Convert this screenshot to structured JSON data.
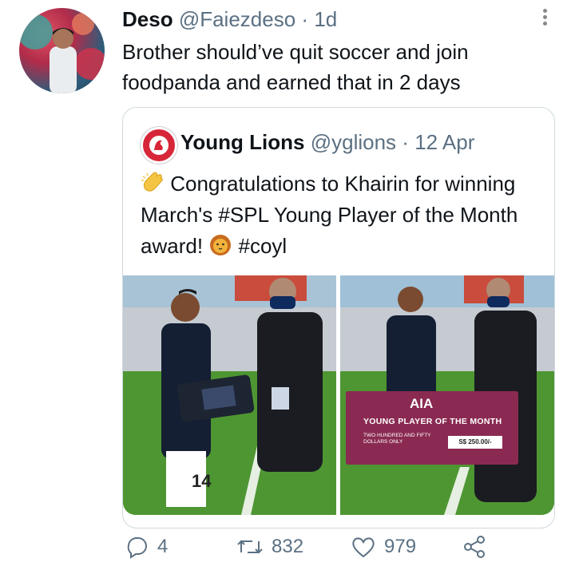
{
  "tweet": {
    "display_name": "Deso",
    "handle": "@Faiezdeso",
    "separator": "·",
    "age": "1d",
    "text": "Brother should’ve quit soccer and join foodpanda and earned that in 2 days"
  },
  "quoted_tweet": {
    "display_name": "Young Lions",
    "handle": "@yglions",
    "separator": "·",
    "date": "12 Apr",
    "text_before": "Congratulations to Khairin for winning March's #SPL Young Player of the Month award!",
    "hashtag_end": "#coyl",
    "emoji_clap": "clapping-hands-emoji",
    "emoji_lion": "lion-face-emoji",
    "photo2_card": {
      "brand": "AIA",
      "title": "YOUNG PLAYER OF THE MONTH",
      "amount_words": "TWO HUNDRED AND FIFTY DOLLARS ONLY",
      "amount": "S$ 250.00/-"
    },
    "shirt_number": "14"
  },
  "actions": {
    "reply_count": "4",
    "retweet_count": "832",
    "like_count": "979"
  },
  "colors": {
    "muted": "#5b7083",
    "border": "#cfd9de",
    "accent": "#d72638"
  }
}
